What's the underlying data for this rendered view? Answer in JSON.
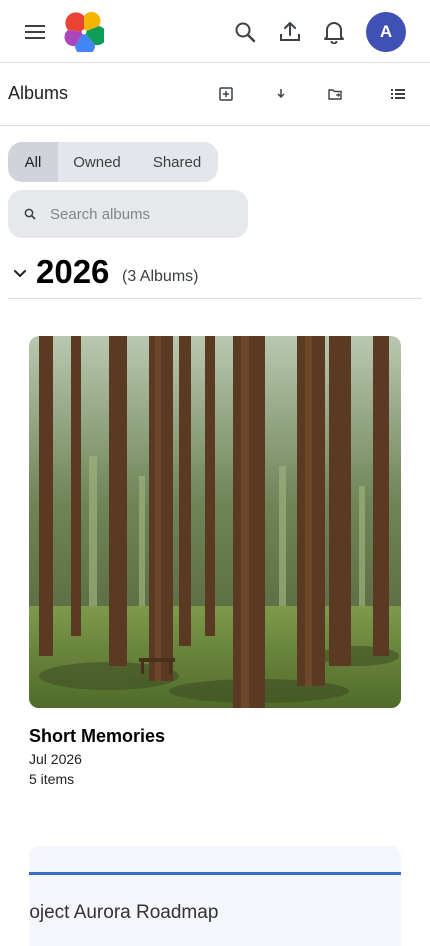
{
  "header": {
    "menu_icon": "hamburger-menu-icon",
    "logo_icon": "pinwheel-logo-icon",
    "search_icon": "search-icon",
    "upload_icon": "upload-icon",
    "notifications_icon": "bell-icon",
    "avatar_initial": "A",
    "avatar_color": "#3f51b5"
  },
  "albums_bar": {
    "title": "Albums",
    "actions": [
      "create-album-icon",
      "download-icon",
      "move-folder-icon",
      "list-view-icon"
    ]
  },
  "filters": {
    "options": [
      "All",
      "Owned",
      "Shared"
    ],
    "selected": "All"
  },
  "search": {
    "placeholder": "Search albums",
    "value": ""
  },
  "section": {
    "year": "2026",
    "count": "(3 Albums)",
    "collapse_icon": "chevron-down-icon"
  },
  "albums": [
    {
      "title": "Short Memories",
      "date": "Jul 2026",
      "items": "5 items",
      "cover": "forest-photo"
    },
    {
      "title": "roject Aurora Roadmap",
      "cover": "document-preview"
    }
  ],
  "colors": {
    "accent": "#3f51b5",
    "segment_bg": "#e3e6ea",
    "segment_active": "#d0d4da",
    "divider": "#dadce0"
  }
}
